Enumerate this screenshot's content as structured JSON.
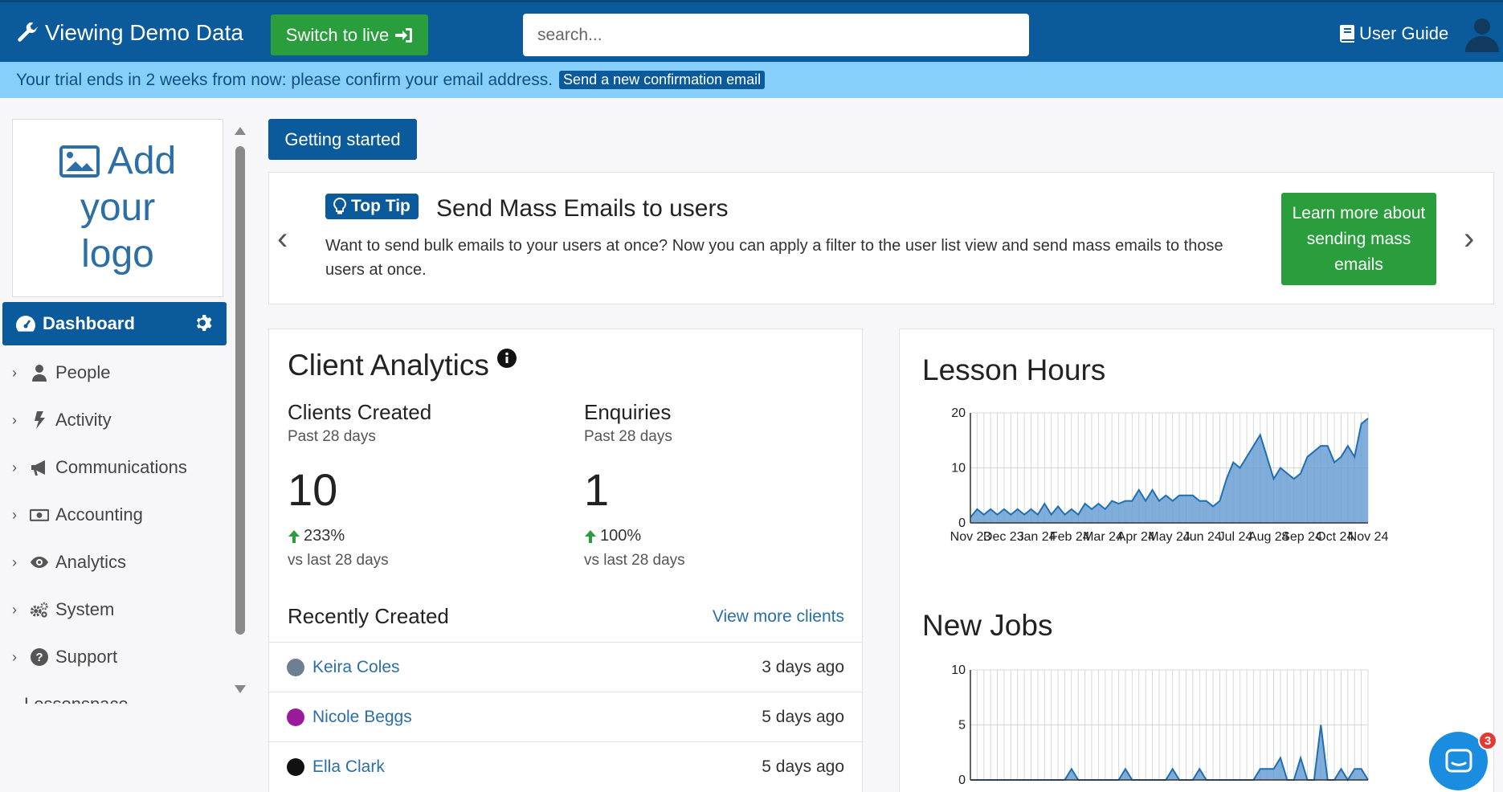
{
  "header": {
    "brand": "Viewing Demo Data",
    "switch_label": "Switch to live",
    "search_placeholder": "search...",
    "guide_label": "User Guide"
  },
  "trial": {
    "message": "Your trial ends in 2 weeks from now: please confirm your email address.",
    "button": "Send a new confirmation email"
  },
  "sidebar": {
    "logo_lines": [
      "Add",
      "your",
      "logo"
    ],
    "active": "Dashboard",
    "items": [
      {
        "label": "People",
        "icon": "user-icon"
      },
      {
        "label": "Activity",
        "icon": "bolt-icon"
      },
      {
        "label": "Communications",
        "icon": "megaphone-icon"
      },
      {
        "label": "Accounting",
        "icon": "money-icon"
      },
      {
        "label": "Analytics",
        "icon": "eye-icon"
      },
      {
        "label": "System",
        "icon": "gears-icon"
      },
      {
        "label": "Support",
        "icon": "question-icon"
      }
    ],
    "cut_item": "Lessonspace"
  },
  "main": {
    "getting_started": "Getting started",
    "tip": {
      "badge": "Top Tip",
      "title": "Send Mass Emails to users",
      "body": "Want to send bulk emails to your users at once? Now you can apply a filter to the user list view and send mass emails to those users at once.",
      "button": "Learn more about sending mass emails"
    },
    "analytics": {
      "title": "Client Analytics",
      "metrics": [
        {
          "label": "Clients Created",
          "sub": "Past 28 days",
          "value": "10",
          "delta": "233%",
          "vs": "vs last 28 days"
        },
        {
          "label": "Enquiries",
          "sub": "Past 28 days",
          "value": "1",
          "delta": "100%",
          "vs": "vs last 28 days"
        }
      ],
      "recent_title": "Recently Created",
      "more_link": "View more clients",
      "recent": [
        {
          "name": "Keira Coles",
          "when": "3 days ago",
          "color": "#6d7f93"
        },
        {
          "name": "Nicole Beggs",
          "when": "5 days ago",
          "color": "#9b1a9b"
        },
        {
          "name": "Ella Clark",
          "when": "5 days ago",
          "color": "#111111"
        }
      ]
    }
  },
  "chart_data": [
    {
      "type": "area",
      "title": "Lesson Hours",
      "x_tick_labels": [
        "Nov 23",
        "Dec 23",
        "Jan 24",
        "Feb 24",
        "Mar 24",
        "Apr 24",
        "May 24",
        "Jun 24",
        "Jul 24",
        "Aug 24",
        "Sep 24",
        "Oct 24",
        "Nov 24"
      ],
      "ylim": [
        0,
        20
      ],
      "yticks": [
        0,
        10,
        20
      ],
      "values": [
        1,
        2.5,
        1.5,
        2.5,
        1.5,
        2.5,
        1.5,
        2.5,
        1.5,
        2.5,
        1.5,
        3.5,
        1.5,
        3,
        1.5,
        2.5,
        1.5,
        3.5,
        2.5,
        3.5,
        2.5,
        4,
        3.5,
        4,
        4,
        6,
        4,
        6,
        4,
        5,
        4,
        5,
        5,
        5,
        4,
        4,
        3,
        4,
        8,
        11,
        10,
        12,
        14,
        16,
        12,
        8,
        10,
        9,
        8,
        9,
        12,
        13,
        14,
        14,
        11,
        12,
        14,
        12,
        18,
        19
      ],
      "color": "#6a9fd4"
    },
    {
      "type": "area",
      "title": "New Jobs",
      "ylim": [
        0,
        10
      ],
      "yticks": [
        0,
        5,
        10
      ],
      "values": [
        0,
        0,
        0,
        0,
        0,
        0,
        0,
        0,
        0,
        0,
        0,
        0,
        0,
        0,
        0,
        1,
        0,
        0,
        0,
        0,
        0,
        0,
        0,
        1,
        0,
        0,
        0,
        0,
        0,
        0,
        1,
        0,
        0,
        0,
        1,
        0,
        0,
        0,
        0,
        0,
        0,
        0,
        0,
        1,
        1,
        1,
        2,
        0,
        0,
        2,
        0,
        0,
        5,
        0,
        0,
        1,
        0,
        1,
        1,
        0
      ],
      "color": "#6a9fd4"
    }
  ],
  "chat": {
    "badge": "3"
  },
  "colors": {
    "primary": "#0b5a9c",
    "success": "#2a9d3c",
    "trial_bg": "#86cffa",
    "link": "#2c6ea6"
  }
}
